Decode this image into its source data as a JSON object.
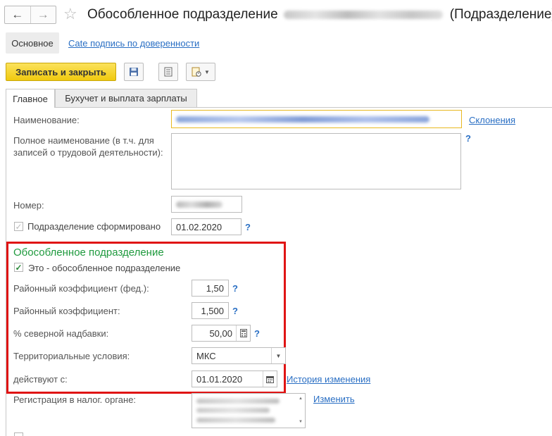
{
  "window": {
    "title_prefix": "Обособленное подразделение",
    "title_suffix": "(Подразделение)"
  },
  "nav": {
    "back_icon": "←",
    "forward_icon": "→",
    "star_icon": "☆"
  },
  "sections": {
    "main_label": "Основное",
    "link_label": "Cate подпись по доверенности"
  },
  "toolbar": {
    "save_close_label": "Записать и закрыть"
  },
  "tabs": [
    {
      "label": "Главное",
      "active": true
    },
    {
      "label": "Бухучет и выплата зарплаты",
      "active": false
    }
  ],
  "form": {
    "name_label": "Наименование:",
    "declensions_link": "Склонения",
    "full_name_label_line1": "Полное наименование (в т.ч. для",
    "full_name_label_line2": "записей о трудовой деятельности):",
    "help_mark": "?",
    "number_label": "Номер:",
    "formed_label": "Подразделение сформировано",
    "formed_date": "01.02.2020"
  },
  "separate_unit": {
    "section_title": "Обособленное подразделение",
    "is_separate_label": "Это - обособленное подразделение",
    "regional_coef_fed_label": "Районный коэффициент (фед.):",
    "regional_coef_fed_value": "1,50",
    "regional_coef_label": "Районный коэффициент:",
    "regional_coef_value": "1,500",
    "north_bonus_label": "% северной надбавки:",
    "north_bonus_value": "50,00",
    "territorial_label": "Территориальные условия:",
    "territorial_value": "МКС",
    "effective_label": "действуют с:",
    "effective_date": "01.01.2020",
    "history_link": "История изменения"
  },
  "tax": {
    "registration_label": "Регистрация в налог. органе:",
    "change_link": "Изменить",
    "scroll_up": "▲",
    "scroll_down": "▼"
  },
  "colors": {
    "accent_yellow": "#f5d327",
    "link_blue": "#2a6fc4",
    "section_green": "#1f9a3e",
    "highlight_red": "#e01414"
  }
}
